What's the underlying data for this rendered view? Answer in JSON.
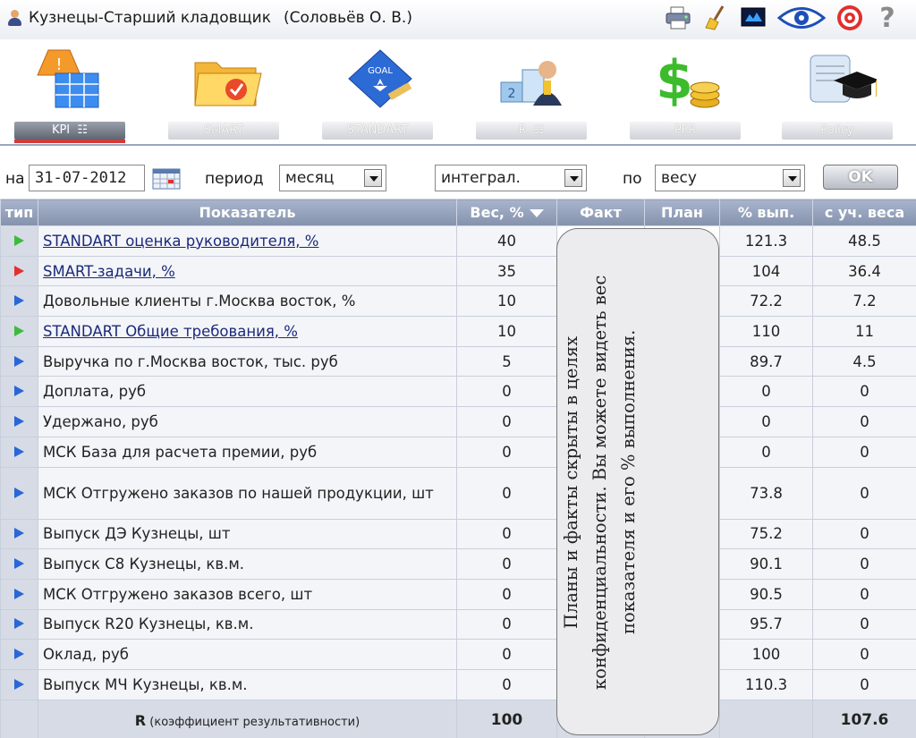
{
  "header": {
    "title": "Кузнецы-Старший кладовщик",
    "user": "(Соловьёв О. В.)",
    "tools": [
      "print-icon",
      "broom-icon",
      "screen-icon",
      "eye-icon",
      "target-icon",
      "help-icon"
    ],
    "help_glyph": "?"
  },
  "modules": [
    {
      "label": "KPI",
      "icon": "kpi-icon",
      "active": true,
      "grid_glyph": "☷"
    },
    {
      "label": "SMART",
      "icon": "folder-icon",
      "active": false
    },
    {
      "label": "STANDART",
      "icon": "goal-icon",
      "active": false
    },
    {
      "label": "R",
      "icon": "podium-icon",
      "active": false,
      "grid_glyph": "☷"
    },
    {
      "label": "PFR",
      "icon": "dollar-icon",
      "active": false
    },
    {
      "label": "Policy",
      "icon": "diploma-icon",
      "active": false
    }
  ],
  "filters": {
    "date_label": "на",
    "date_value": "31-07-2012",
    "period_label": "период",
    "period_value": "месяц",
    "mode_value": "интеграл.",
    "by_label": "по",
    "by_value": "весу",
    "ok_label": "OK"
  },
  "table": {
    "headers": {
      "type": "тип",
      "name": "Показатель",
      "weight": "Вес, %",
      "fact": "Факт",
      "plan": "План",
      "pct": "% вып.",
      "weighted": "с уч. веса"
    },
    "rows": [
      {
        "marker": "green",
        "name": "STANDART оценка руководителя, %",
        "link": true,
        "weight": "40",
        "pct": "121.3",
        "weighted": "48.5"
      },
      {
        "marker": "red",
        "name": "SMART-задачи, %",
        "link": true,
        "weight": "35",
        "pct": "104",
        "weighted": "36.4"
      },
      {
        "marker": "blue",
        "name": "Довольные клиенты г.Москва восток, %",
        "link": false,
        "weight": "10",
        "pct": "72.2",
        "weighted": "7.2"
      },
      {
        "marker": "green",
        "name": "STANDART Общие требования, %",
        "link": true,
        "weight": "10",
        "pct": "110",
        "weighted": "11"
      },
      {
        "marker": "blue",
        "name": "Выручка по г.Москва восток, тыс. руб",
        "link": false,
        "weight": "5",
        "pct": "89.7",
        "weighted": "4.5"
      },
      {
        "marker": "blue",
        "name": "Доплата, руб",
        "link": false,
        "weight": "0",
        "pct": "0",
        "weighted": "0"
      },
      {
        "marker": "blue",
        "name": "Удержано, руб",
        "link": false,
        "weight": "0",
        "pct": "0",
        "weighted": "0"
      },
      {
        "marker": "blue",
        "name": "МСК База для расчета премии, руб",
        "link": false,
        "weight": "0",
        "pct": "0",
        "weighted": "0"
      },
      {
        "marker": "blue",
        "name": "МСК Отгружено заказов по нашей продукции, шт",
        "link": false,
        "weight": "0",
        "pct": "73.8",
        "weighted": "0",
        "tall": true
      },
      {
        "marker": "blue",
        "name": "Выпуск ДЭ Кузнецы, шт",
        "link": false,
        "weight": "0",
        "pct": "75.2",
        "weighted": "0"
      },
      {
        "marker": "blue",
        "name": "Выпуск С8 Кузнецы, кв.м.",
        "link": false,
        "weight": "0",
        "pct": "90.1",
        "weighted": "0"
      },
      {
        "marker": "blue",
        "name": "МСК Отгружено заказов всего, шт",
        "link": false,
        "weight": "0",
        "pct": "90.5",
        "weighted": "0"
      },
      {
        "marker": "blue",
        "name": "Выпуск R20 Кузнецы, кв.м.",
        "link": false,
        "weight": "0",
        "pct": "95.7",
        "weighted": "0"
      },
      {
        "marker": "blue",
        "name": "Оклад, руб",
        "link": false,
        "weight": "0",
        "pct": "100",
        "weighted": "0"
      },
      {
        "marker": "blue",
        "name": "Выпуск МЧ Кузнецы, кв.м.",
        "link": false,
        "weight": "0",
        "pct": "110.3",
        "weighted": "0"
      }
    ],
    "footer": {
      "r_letter": "R",
      "r_text": "(коэффициент результативности)",
      "weight_total": "100",
      "weighted_total": "107.6"
    }
  },
  "note": "Планы и факты скрыты в целях конфиденциальности. Вы можете видеть вес показателя и его % выполнения."
}
